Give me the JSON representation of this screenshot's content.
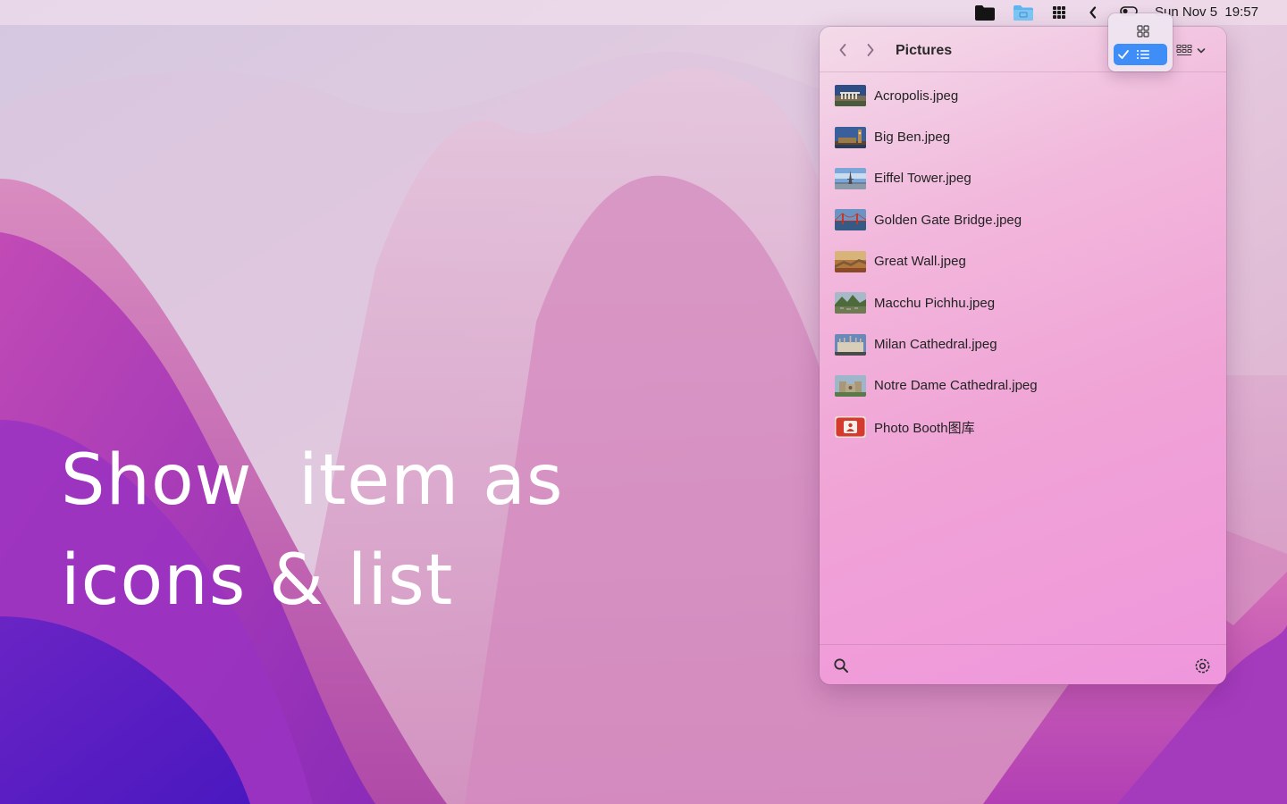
{
  "headline": {
    "line1": "Show  item as",
    "line2": "icons & list"
  },
  "menubar": {
    "clock_date": "Sun Nov 5",
    "clock_time": "19:57",
    "icons": [
      "folder-icon",
      "finder-folder-icon",
      "grid-apps-icon",
      "chevron-left-icon",
      "toggle-icon"
    ]
  },
  "panel": {
    "title": "Pictures",
    "files": [
      {
        "name": "Acropolis.jpeg",
        "thumb": "acropolis"
      },
      {
        "name": "Big Ben.jpeg",
        "thumb": "bigben"
      },
      {
        "name": "Eiffel Tower.jpeg",
        "thumb": "eiffel"
      },
      {
        "name": "Golden Gate Bridge.jpeg",
        "thumb": "goldengate"
      },
      {
        "name": "Great Wall.jpeg",
        "thumb": "greatwall"
      },
      {
        "name": "Macchu Pichhu.jpeg",
        "thumb": "machupicchu"
      },
      {
        "name": "Milan Cathedral.jpeg",
        "thumb": "milan"
      },
      {
        "name": "Notre Dame Cathedral.jpeg",
        "thumb": "notredame"
      },
      {
        "name": "Photo Booth图库",
        "thumb": "photobooth"
      }
    ]
  },
  "view_menu": {
    "options": [
      "icons",
      "list"
    ],
    "selected": "list"
  },
  "colors": {
    "accent": "#3f8ef7",
    "headline": "#ffffff"
  }
}
